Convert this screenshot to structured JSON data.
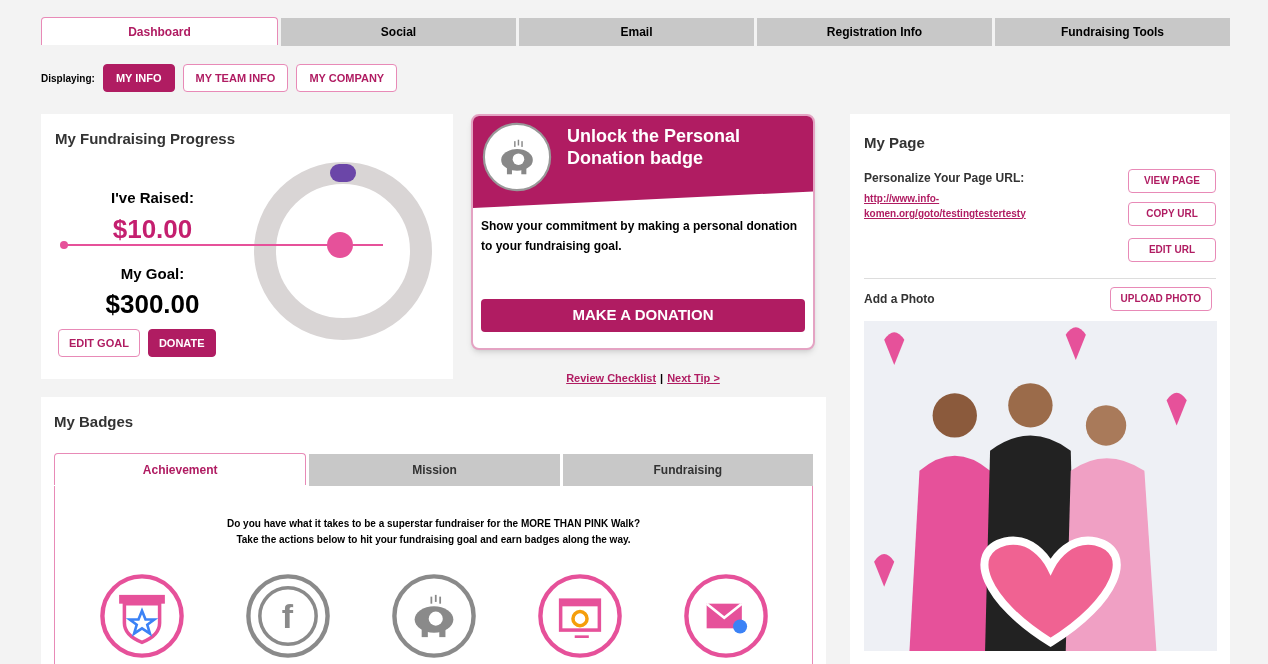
{
  "tabs": [
    {
      "label": "Dashboard",
      "selected": true
    },
    {
      "label": "Social",
      "selected": false
    },
    {
      "label": "Email",
      "selected": false
    },
    {
      "label": "Registration Info",
      "selected": false
    },
    {
      "label": "Fundraising Tools",
      "selected": false
    }
  ],
  "displaying": {
    "label": "Displaying:",
    "options": [
      {
        "label": "MY INFO",
        "selected": true
      },
      {
        "label": "MY TEAM INFO",
        "selected": false
      },
      {
        "label": "MY COMPANY",
        "selected": false
      }
    ]
  },
  "progress": {
    "title": "My Fundraising Progress",
    "raised_label": "I've Raised:",
    "raised": "$10.00",
    "goal_label": "My Goal:",
    "goal": "$300.00",
    "buttons": [
      {
        "label": "EDIT GOAL",
        "primary": false
      },
      {
        "label": "DONATE",
        "primary": true
      }
    ]
  },
  "tip": {
    "title": "Unlock the Personal Donation badge",
    "text": "Show your commitment by making a personal donation to your fundraising goal.",
    "button": "MAKE A DONATION",
    "links": [
      "Review Checklist",
      "Next Tip >"
    ],
    "separator": "|"
  },
  "badges": {
    "title": "My Badges",
    "tabs": [
      {
        "label": "Achievement",
        "selected": true
      },
      {
        "label": "Mission",
        "selected": false
      },
      {
        "label": "Fundraising",
        "selected": false
      }
    ],
    "intro": [
      "Do you have what it takes to be a superstar fundraiser for the MORE THAN PINK Walk?",
      "Take the actions below to hit your fundraising goal and earn badges along the way."
    ],
    "items": [
      {
        "kind": "shield",
        "earned": true
      },
      {
        "kind": "facebook",
        "earned": false,
        "glyph": "f"
      },
      {
        "kind": "piggy",
        "earned": false
      },
      {
        "kind": "browser",
        "earned": true
      },
      {
        "kind": "mail",
        "earned": true
      }
    ]
  },
  "my_page": {
    "title": "My Page",
    "url_label": "Personalize Your Page URL:",
    "url": "http://www.info-komen.org/goto/testingtestertesty",
    "buttons": [
      "VIEW PAGE",
      "COPY URL",
      "EDIT URL"
    ],
    "photo_label": "Add a Photo",
    "upload": "UPLOAD PHOTO"
  }
}
